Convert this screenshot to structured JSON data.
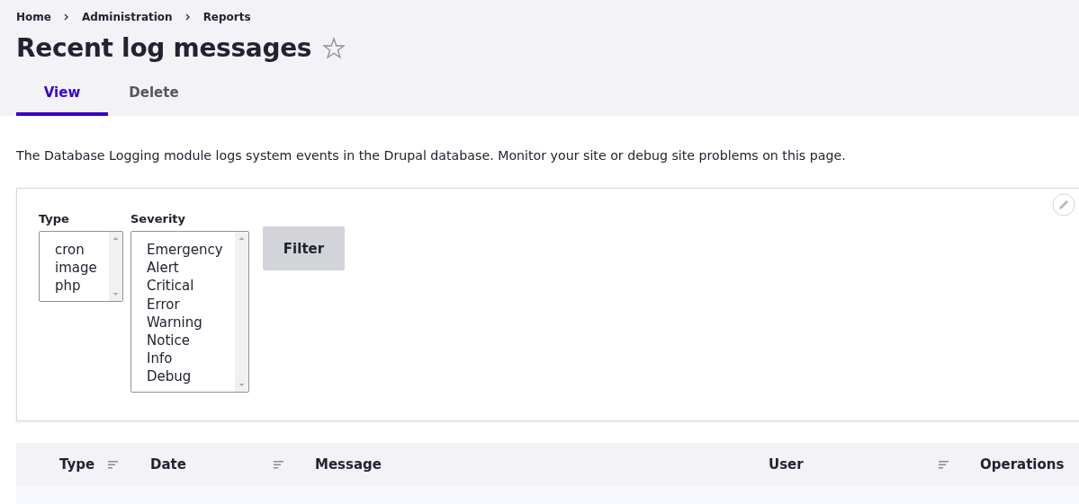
{
  "breadcrumb": [
    "Home",
    "Administration",
    "Reports"
  ],
  "title": "Recent log messages",
  "tabs": [
    {
      "label": "View",
      "selected": true
    },
    {
      "label": "Delete",
      "selected": false
    }
  ],
  "description": "The Database Logging module logs system events in the Drupal database. Monitor your site or debug site problems on this page.",
  "filters": [
    {
      "label": "Type",
      "options": [
        "cron",
        "image",
        "php"
      ]
    },
    {
      "label": "Severity",
      "options": [
        "Emergency",
        "Alert",
        "Critical",
        "Error",
        "Warning",
        "Notice",
        "Info",
        "Debug"
      ]
    }
  ],
  "filter_button": "Filter",
  "table": {
    "columns": [
      {
        "label": "Type",
        "sortable": true
      },
      {
        "label": "Date",
        "sortable": true
      },
      {
        "label": "Message",
        "sortable": false
      },
      {
        "label": "User",
        "sortable": true
      },
      {
        "label": "Operations",
        "sortable": false
      }
    ]
  }
}
